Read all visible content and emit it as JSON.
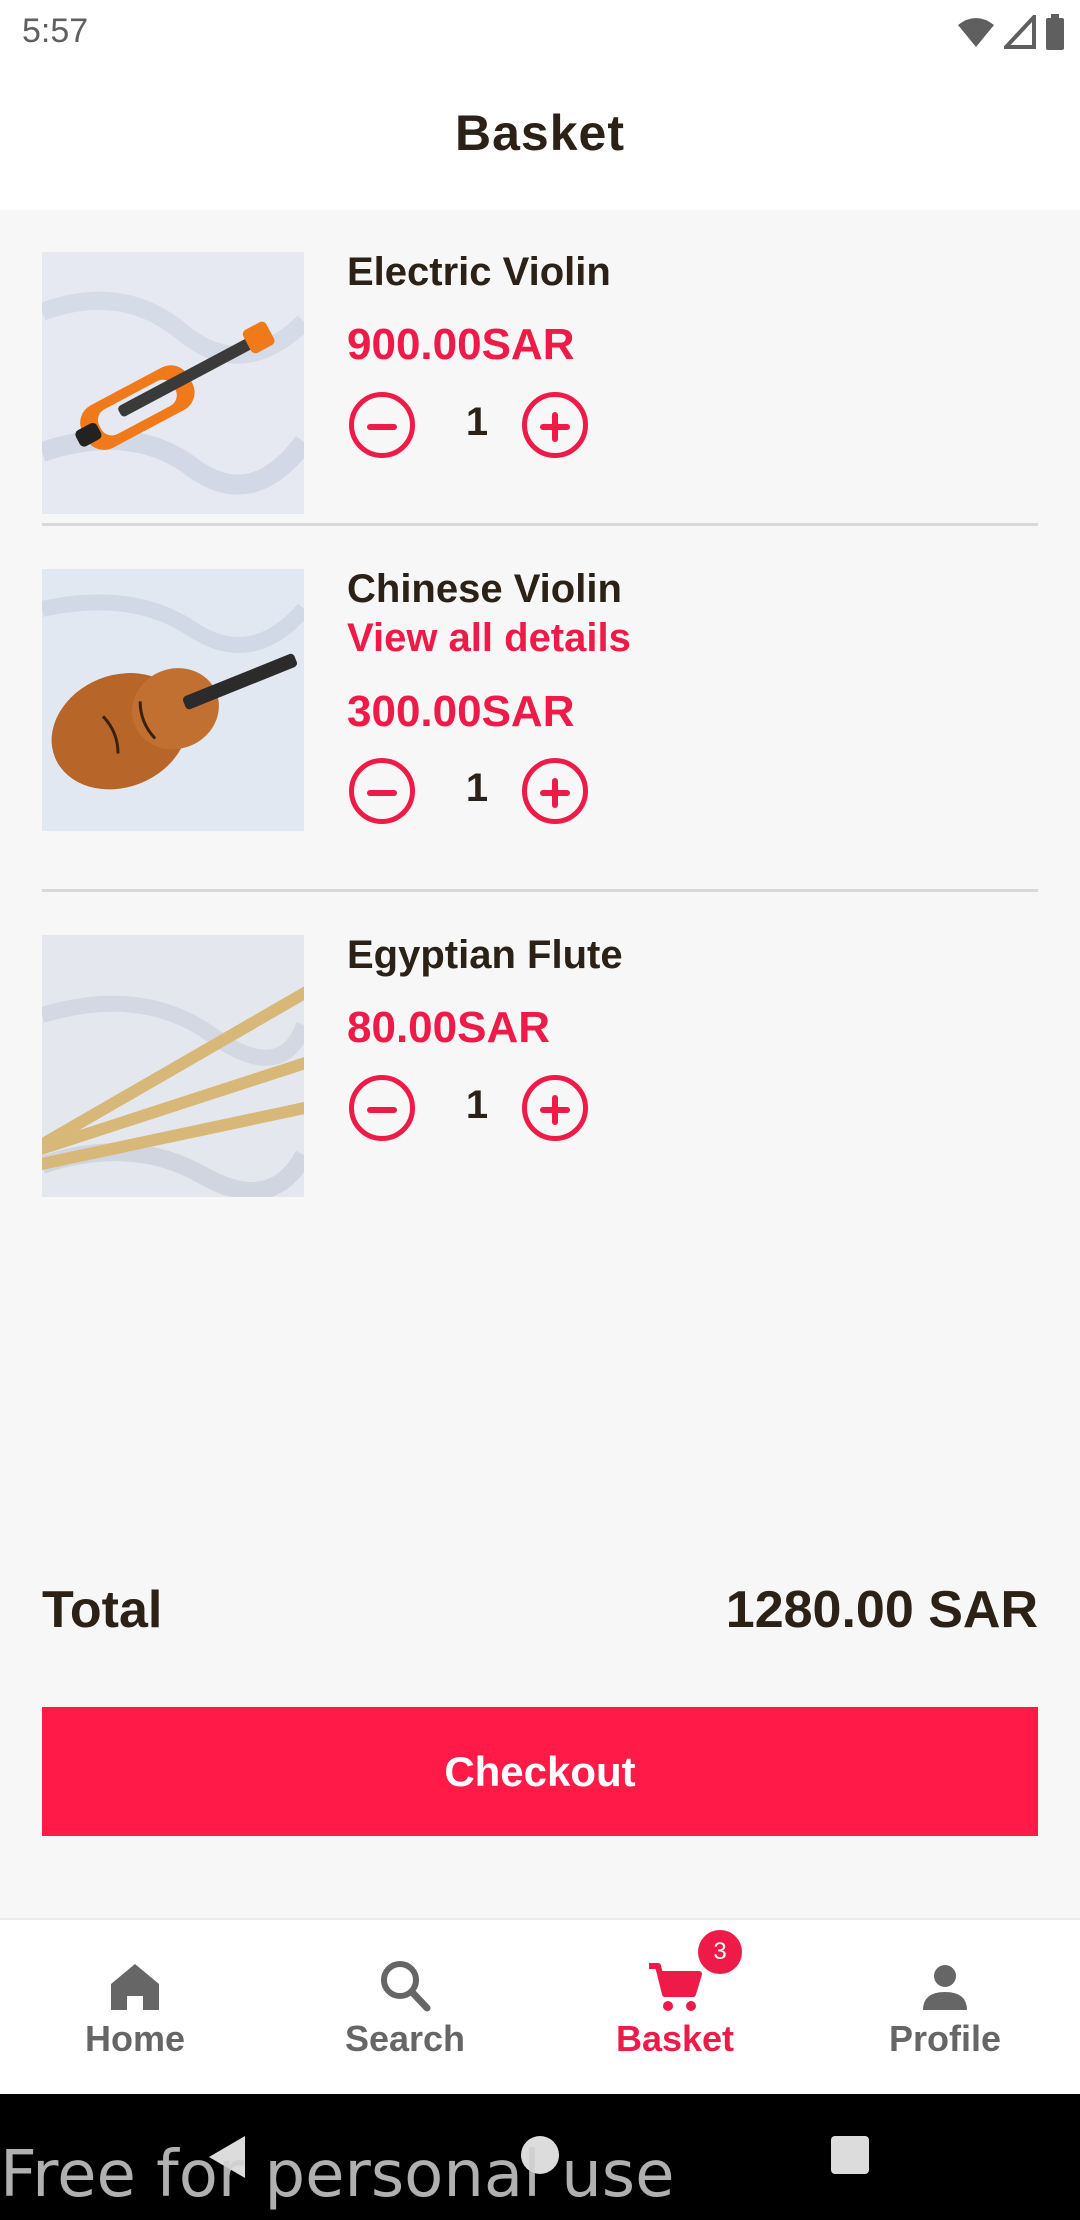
{
  "status_bar": {
    "time": "5:57"
  },
  "header": {
    "title": "Basket"
  },
  "items": [
    {
      "name": "Electric Violin",
      "price": "900.00SAR",
      "qty": "1",
      "thumb": "electric-violin-photo"
    },
    {
      "name": "Chinese Violin",
      "link": "View all details",
      "price": "300.00SAR",
      "qty": "1",
      "thumb": "chinese-violin-photo"
    },
    {
      "name": "Egyptian Flute",
      "price": "80.00SAR",
      "qty": "1",
      "thumb": "egyptian-flute-photo"
    }
  ],
  "summary": {
    "total_label": "Total",
    "total_value": "1280.00 SAR",
    "checkout_label": "Checkout"
  },
  "nav": {
    "items": [
      {
        "label": "Home",
        "icon": "home-icon"
      },
      {
        "label": "Search",
        "icon": "search-icon"
      },
      {
        "label": "Basket",
        "icon": "cart-icon",
        "badge": "3",
        "active": true
      },
      {
        "label": "Profile",
        "icon": "person-icon"
      }
    ]
  },
  "watermark": "Free for personal use",
  "colors": {
    "accent": "#ee1a47",
    "text": "#2b2117",
    "background": "#f7f7f7"
  }
}
